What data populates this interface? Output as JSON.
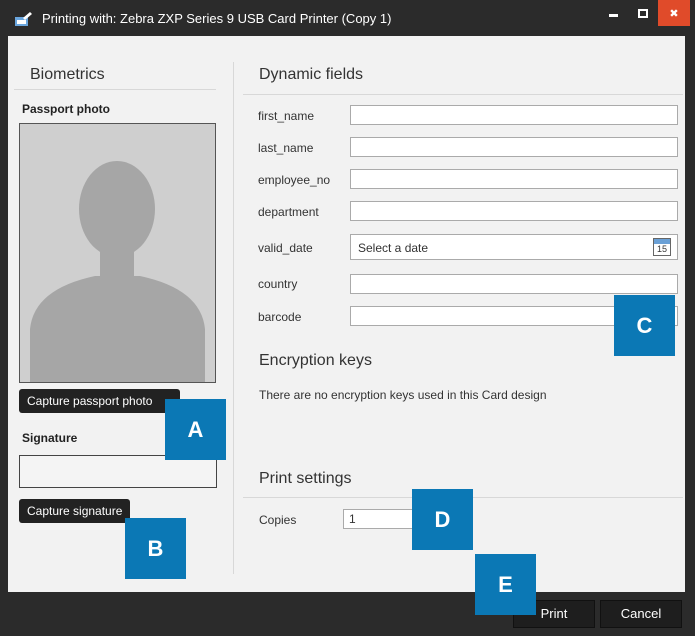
{
  "window": {
    "title": "Printing with: Zebra ZXP Series 9 USB Card Printer (Copy 1)",
    "controls": {
      "minimize": "‒",
      "maximize": "□",
      "close": "✖"
    },
    "close_color": "#e04b2a"
  },
  "biometrics": {
    "heading": "Biometrics",
    "passport_photo_label": "Passport photo",
    "capture_photo_button": "Capture passport photo",
    "signature_label": "Signature",
    "capture_signature_button": "Capture signature"
  },
  "dynamic_fields": {
    "heading": "Dynamic fields",
    "fields": [
      {
        "label": "first_name",
        "value": ""
      },
      {
        "label": "last_name",
        "value": ""
      },
      {
        "label": "employee_no",
        "value": ""
      },
      {
        "label": "department",
        "value": ""
      },
      {
        "label": "valid_date",
        "placeholder": "Select a date",
        "calendar_day": "15"
      },
      {
        "label": "country",
        "value": ""
      },
      {
        "label": "barcode",
        "value": ""
      }
    ]
  },
  "encryption": {
    "heading": "Encryption keys",
    "message": "There are no encryption keys used in this Card design"
  },
  "print_settings": {
    "heading": "Print settings",
    "copies_label": "Copies",
    "copies_value": "1"
  },
  "footer": {
    "print_button": "Print",
    "cancel_button": "Cancel"
  },
  "callouts": {
    "a": "A",
    "b": "B",
    "c": "C",
    "d": "D",
    "e": "E",
    "color": "#0b78b5"
  }
}
